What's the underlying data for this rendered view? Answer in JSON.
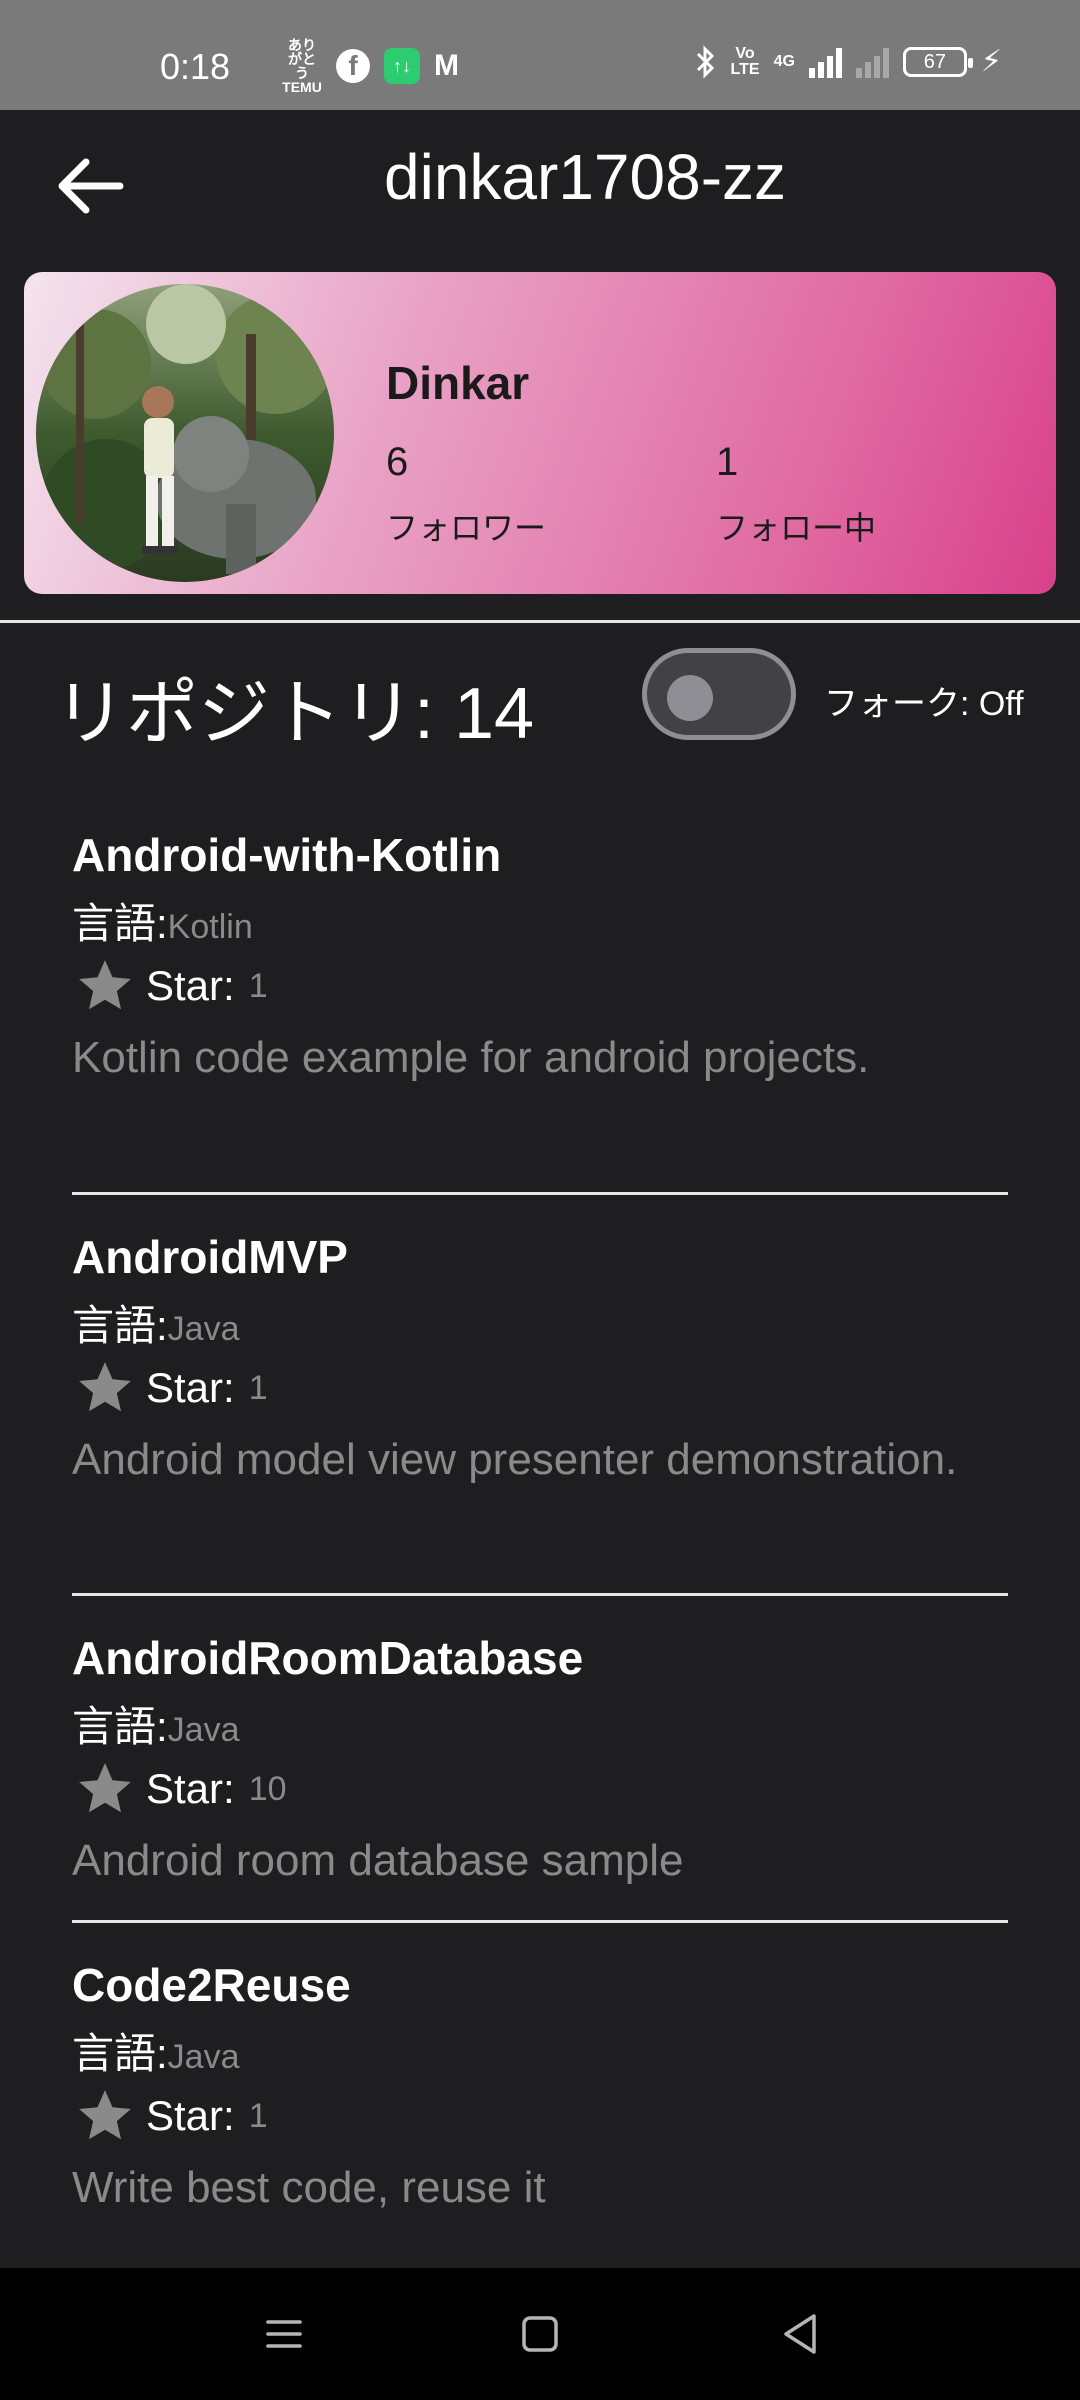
{
  "status_bar": {
    "time": "0:18",
    "left_icons": [
      "temu-icon",
      "facebook-icon",
      "app-icon",
      "gmail-icon"
    ],
    "temu_text": "ありがとう\nTEMU",
    "volte_text": "Vo\nLTE",
    "net_text": "4G",
    "battery": "67"
  },
  "app_bar": {
    "title": "dinkar1708-zz"
  },
  "profile": {
    "name": "Dinkar",
    "followers_count": "6",
    "followers_label": "フォロワー",
    "following_count": "1",
    "following_label": "フォロー中"
  },
  "repos_header": {
    "title": "リポジトリ: 14",
    "fork_label": "フォーク: Off",
    "fork_enabled": false
  },
  "repos": [
    {
      "name": "Android-with-Kotlin",
      "lang_label": "言語:",
      "language": "Kotlin",
      "star_label": "Star:",
      "stars": "1",
      "description": "Kotlin code example for android projects."
    },
    {
      "name": "AndroidMVP",
      "lang_label": "言語:",
      "language": "Java",
      "star_label": "Star:",
      "stars": "1",
      "description": "Android model view presenter demonstration."
    },
    {
      "name": "AndroidRoomDatabase",
      "lang_label": "言語:",
      "language": "Java",
      "star_label": "Star:",
      "stars": "10",
      "description": "Android room database sample"
    },
    {
      "name": "Code2Reuse",
      "lang_label": "言語:",
      "language": "Java",
      "star_label": "Star:",
      "stars": "1",
      "description": "Write best code, reuse it"
    }
  ],
  "colors": {
    "background": "#1e1e20",
    "card_gradient_start": "#f4e4ee",
    "card_gradient_end": "#d9418a",
    "muted_text": "#8a8a8a",
    "status_bar": "#7a7a7a"
  }
}
